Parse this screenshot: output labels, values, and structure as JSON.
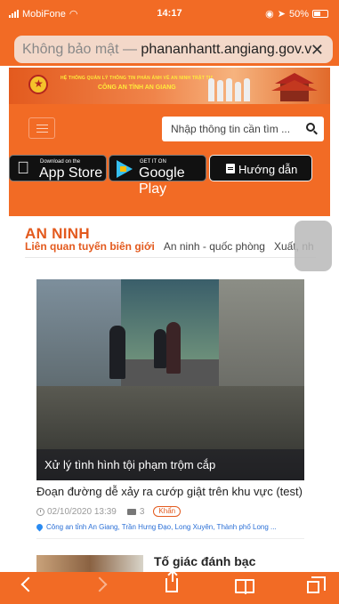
{
  "statusbar": {
    "carrier": "MobiFone",
    "time": "14:17",
    "battery": "50%"
  },
  "urlbar": {
    "insecure_label": "Không bảo mật —",
    "host": "phananhantt.angiang.gov.v",
    "close": "✕"
  },
  "banner": {
    "line1": "HỆ THỐNG QUẢN LÝ THÔNG TIN PHẢN ÁNH VỀ AN NINH TRẬT TỰ",
    "line2": "CÔNG AN TỈNH AN GIANG"
  },
  "header": {
    "search_placeholder": "Nhập thông tin cần tìm ...",
    "appstore_small": "Download on the",
    "appstore_big": "App Store",
    "googleplay_small": "GET IT ON",
    "googleplay_big": "Google Play",
    "guide": "Hướng dẫn"
  },
  "section": {
    "title": "AN NINH",
    "subnav": [
      {
        "label": "Liên quan tuyến biên giới"
      },
      {
        "label": "An ninh - quốc phòng"
      },
      {
        "label": "Xuất, nh"
      }
    ]
  },
  "news": [
    {
      "image_caption": "Xử lý tình hình tội phạm trộm cắp",
      "title": "Đoạn đường dễ xảy ra cướp giật trên khu vực (test)",
      "date": "02/10/2020 13:39",
      "comments": "3",
      "badge": "Khẩn",
      "location": "Công an tỉnh An Giang, Trần Hưng Đạo, Long Xuyên, Thành phố Long ..."
    },
    {
      "title": "Tố giác đánh bạc"
    }
  ],
  "colors": {
    "accent": "#f26b25",
    "section_title": "#e35a1e",
    "link": "#2a6fd6"
  }
}
